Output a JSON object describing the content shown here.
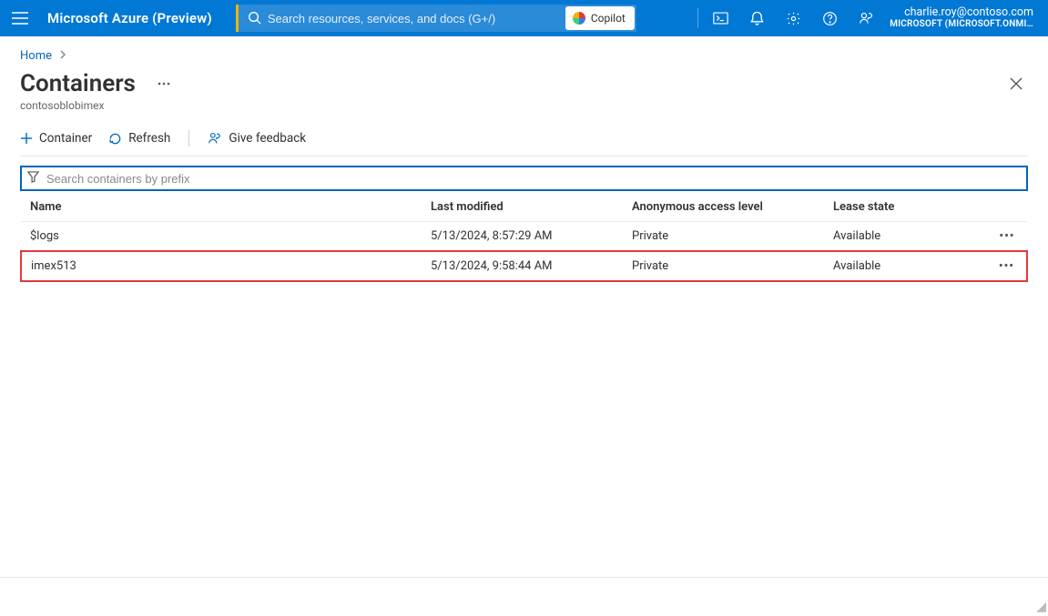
{
  "header": {
    "brand": "Microsoft Azure (Preview)",
    "search_placeholder": "Search resources, services, and docs (G+/)",
    "copilot_label": "Copilot",
    "account_email": "charlie.roy@contoso.com",
    "account_tenant": "MICROSOFT (MICROSOFT.ONMI…"
  },
  "breadcrumb": {
    "items": [
      "Home"
    ]
  },
  "page": {
    "title": "Containers",
    "subtitle": "contosoblobimex"
  },
  "commands": {
    "container": "Container",
    "refresh": "Refresh",
    "feedback": "Give feedback"
  },
  "filter": {
    "placeholder": "Search containers by prefix"
  },
  "table": {
    "columns": {
      "name": "Name",
      "last_modified": "Last modified",
      "access": "Anonymous access level",
      "lease": "Lease state"
    },
    "rows": [
      {
        "name": "$logs",
        "last_modified": "5/13/2024, 8:57:29 AM",
        "access": "Private",
        "lease": "Available",
        "highlight": false
      },
      {
        "name": "imex513",
        "last_modified": "5/13/2024, 9:58:44 AM",
        "access": "Private",
        "lease": "Available",
        "highlight": true
      }
    ]
  }
}
